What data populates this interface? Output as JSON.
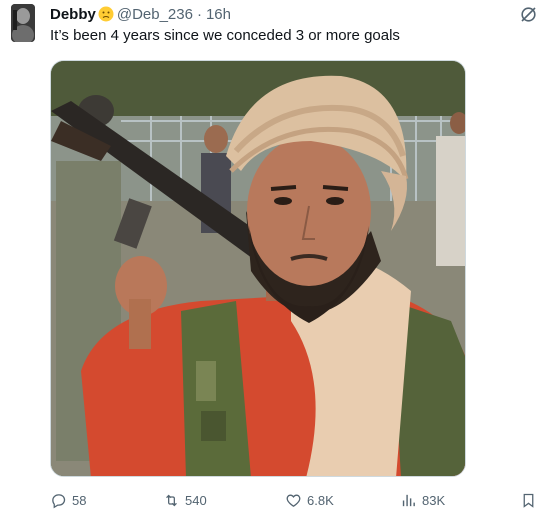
{
  "author": {
    "display_name": "Debby",
    "emoji": "confused-face-emoji",
    "handle": "@Deb_236",
    "separator": "·",
    "time": "16h"
  },
  "tweet": {
    "text": "It’s been 4 years since we conceded 3 or more goals"
  },
  "actions": {
    "replies": "58",
    "retweets": "540",
    "likes": "6.8K",
    "views": "83K"
  },
  "icons": {
    "grok": "grok-icon",
    "reply": "reply-icon",
    "retweet": "retweet-icon",
    "like": "heart-icon",
    "views": "views-icon",
    "bookmark": "bookmark-icon"
  },
  "colors": {
    "text_primary": "#0f1419",
    "text_secondary": "#536471",
    "border": "#cfd9de"
  }
}
